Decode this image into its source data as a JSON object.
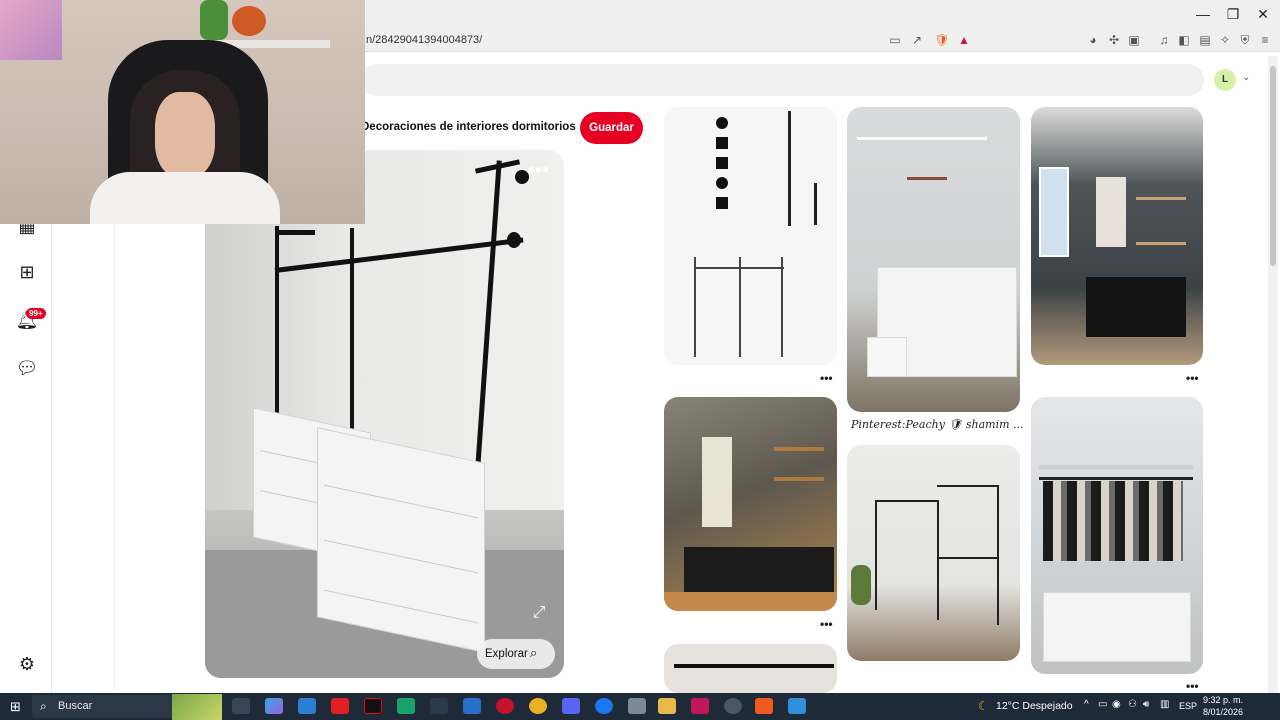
{
  "browser": {
    "url": "n/284290413940048​73/",
    "window_buttons": {
      "minimize": "—",
      "restore": "❐",
      "close": "✕"
    }
  },
  "pinterest": {
    "avatar_initial": "L",
    "board_name": "Decoraciones de interiores dormitorios",
    "save_label": "Guardar",
    "explore_label": "Explorar",
    "notification_badge": "99+",
    "more_dots": "•••",
    "grid_caption": "Pinterest:Peachy 🛡 shamim ...",
    "pin_dots": "•••",
    "brand_color": "#e60023"
  },
  "taskbar": {
    "search_label": "Buscar",
    "weather": "12°C  Despejado",
    "language": "ESP",
    "time": "9:32 p. m.",
    "date": "8/01/2026"
  }
}
